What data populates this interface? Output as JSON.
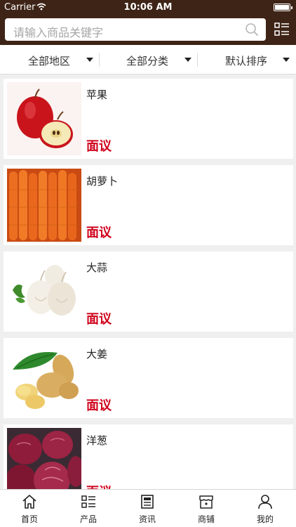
{
  "status_bar": {
    "carrier": "Carrier",
    "time": "10:06 AM"
  },
  "search": {
    "placeholder": "请输入商品关键字"
  },
  "filters": [
    {
      "label": "全部地区"
    },
    {
      "label": "全部分类"
    },
    {
      "label": "默认排序"
    }
  ],
  "products": [
    {
      "name": "苹果",
      "price": "面议",
      "image": "apple"
    },
    {
      "name": "胡萝卜",
      "price": "面议",
      "image": "carrot"
    },
    {
      "name": "大蒜",
      "price": "面议",
      "image": "garlic"
    },
    {
      "name": "大姜",
      "price": "面议",
      "image": "ginger"
    },
    {
      "name": "洋葱",
      "price": "面议",
      "image": "onion"
    }
  ],
  "tabs": [
    {
      "label": "首页",
      "icon": "home-icon"
    },
    {
      "label": "产品",
      "icon": "grid-list-icon"
    },
    {
      "label": "资讯",
      "icon": "news-icon"
    },
    {
      "label": "商铺",
      "icon": "store-icon"
    },
    {
      "label": "我的",
      "icon": "person-icon"
    }
  ],
  "colors": {
    "header": "#3e2417",
    "price": "#d0011b",
    "background": "#efefef"
  }
}
